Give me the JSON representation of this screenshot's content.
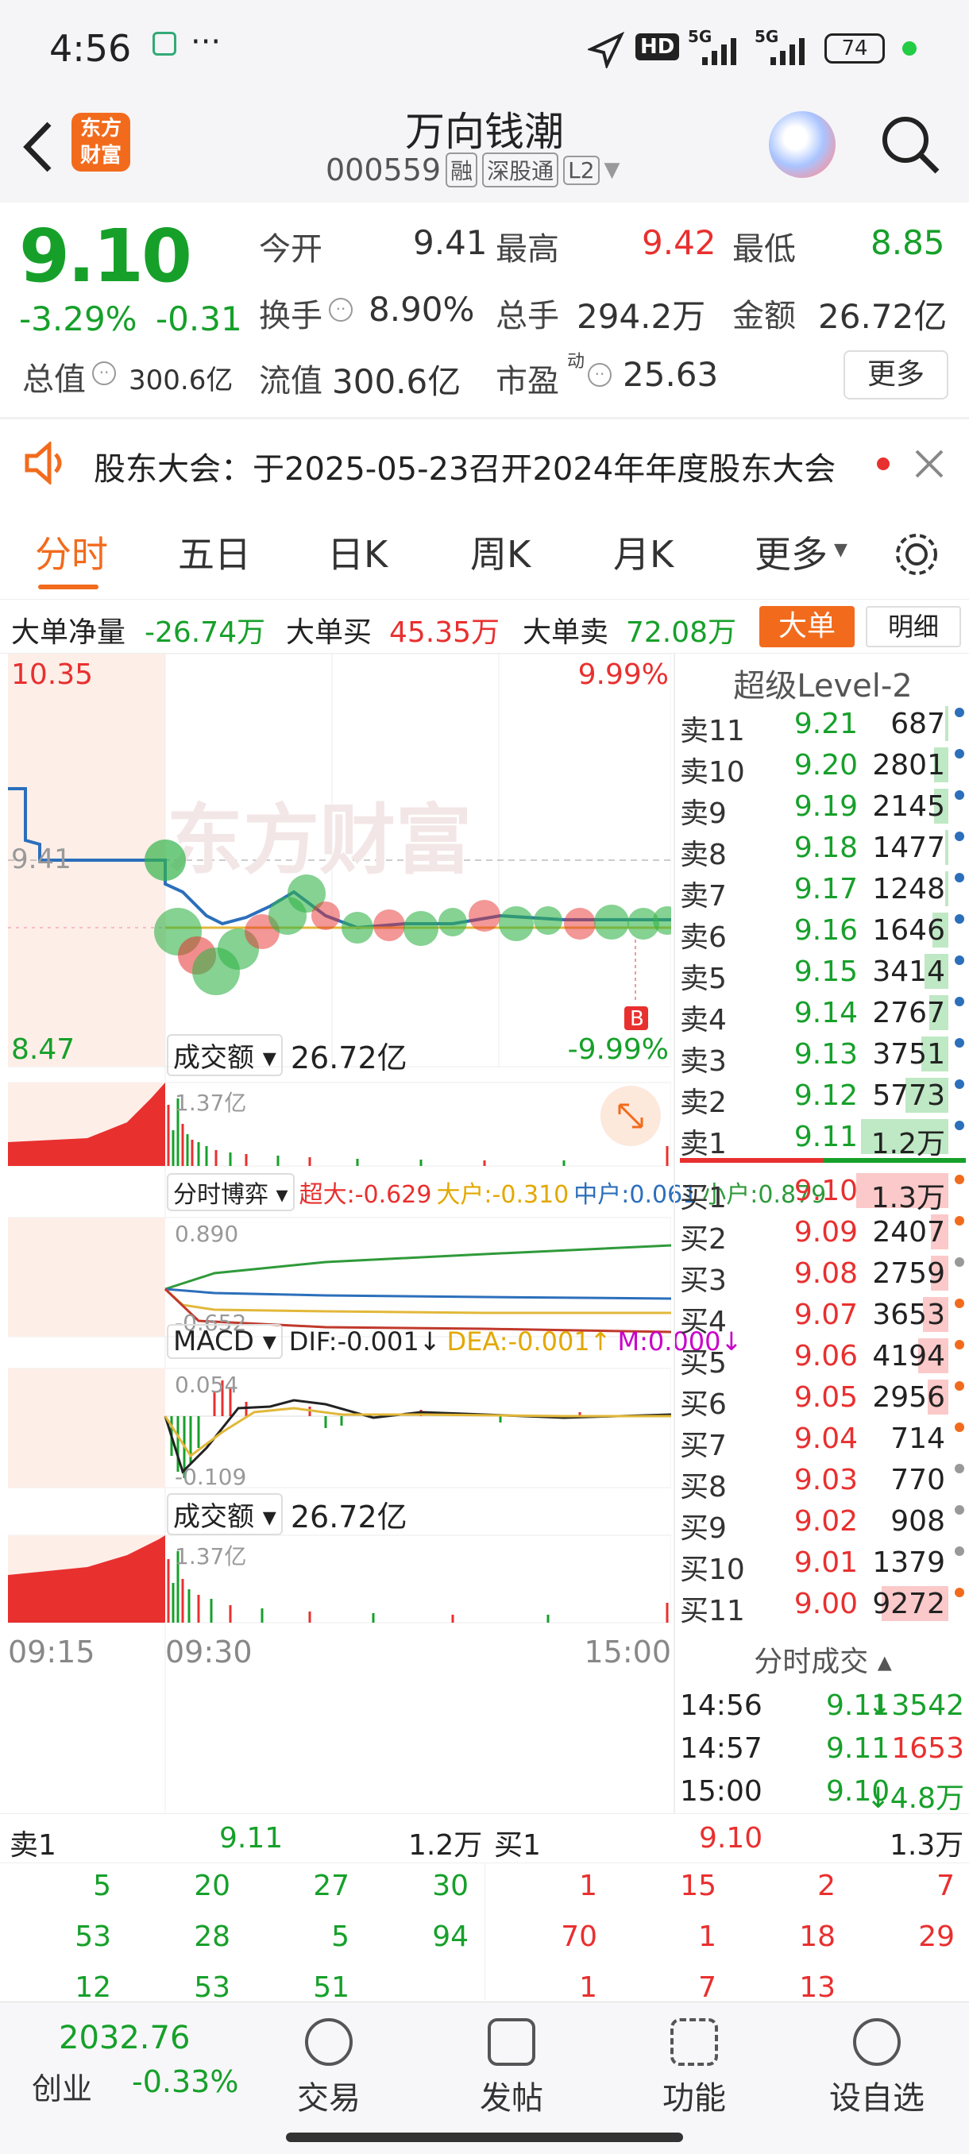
{
  "status": {
    "time": "4:56",
    "dots": "···",
    "hd": "HD",
    "sig1": "5G",
    "sig2": "5G",
    "battery": "74"
  },
  "header": {
    "title": "万向钱潮",
    "code": "000559",
    "tag_rong": "融",
    "tag_sgt": "深股通",
    "tag_l2": "L2",
    "logo_text": "东方财富"
  },
  "quote": {
    "price": "9.10",
    "pct": "-3.29%",
    "chg": "-0.31",
    "open_l": "今开",
    "open_v": "9.41",
    "high_l": "最高",
    "high_v": "9.42",
    "low_l": "最低",
    "low_v": "8.85",
    "turn_l": "换手",
    "turn_v": "8.90%",
    "vol_l": "总手",
    "vol_v": "294.2万",
    "amt_l": "金额",
    "amt_v": "26.72亿",
    "mcap_l": "总值",
    "mcap_v": "300.6亿",
    "fmcap_l": "流值",
    "fmcap_v": "300.6亿",
    "pe_l": "市盈",
    "pe_sup": "动",
    "pe_v": "25.63",
    "more": "更多"
  },
  "notice": {
    "text": "股东大会：于2025-05-23召开2024年年度股东大会"
  },
  "tabs": [
    "分时",
    "五日",
    "日K",
    "周K",
    "月K",
    "更多",
    ""
  ],
  "bigorder": {
    "net_l": "大单净量",
    "net_v": "-26.74万",
    "buy_l": "大单买",
    "buy_v": "45.35万",
    "sell_l": "大单卖",
    "sell_v": "72.08万",
    "btn": "大单",
    "detail": "明细"
  },
  "chart": {
    "ymax": "10.35",
    "ymin": "8.47",
    "pmax": "9.99%",
    "pmin": "-9.99%",
    "prev": "9.41",
    "b_mark": "B",
    "vol_title": "成交额",
    "vol_val": "26.72亿",
    "vol_max": "1.37亿",
    "game_title": "分时博弈",
    "game_big": "超大:-0.629",
    "game_large": "大户:-0.310",
    "game_mid": "中户:0.061",
    "game_small": "小户:0.879",
    "game_max": "0.890",
    "game_min": "-0.652",
    "macd_title": "MACD",
    "dif": "DIF:-0.001↓",
    "dea": "DEA:-0.001↑",
    "m": "M:0.000↓",
    "macd_max": "0.054",
    "macd_min": "-0.109",
    "vol2_title": "成交额",
    "vol2_val": "26.72亿",
    "vol2_max": "1.37亿",
    "t0": "09:15",
    "t1": "09:30",
    "t2": "15:00",
    "watermark": "东方财富"
  },
  "orderbook": {
    "title": "超级Level-2",
    "asks": [
      {
        "l": "卖11",
        "p": "9.21",
        "v": "687"
      },
      {
        "l": "卖10",
        "p": "9.20",
        "v": "2801"
      },
      {
        "l": "卖9",
        "p": "9.19",
        "v": "2145"
      },
      {
        "l": "卖8",
        "p": "9.18",
        "v": "1477"
      },
      {
        "l": "卖7",
        "p": "9.17",
        "v": "1248"
      },
      {
        "l": "卖6",
        "p": "9.16",
        "v": "1646"
      },
      {
        "l": "卖5",
        "p": "9.15",
        "v": "3414"
      },
      {
        "l": "卖4",
        "p": "9.14",
        "v": "2767"
      },
      {
        "l": "卖3",
        "p": "9.13",
        "v": "3751"
      },
      {
        "l": "卖2",
        "p": "9.12",
        "v": "5773"
      },
      {
        "l": "卖1",
        "p": "9.11",
        "v": "1.2万"
      }
    ],
    "bids": [
      {
        "l": "买1",
        "p": "9.10",
        "v": "1.3万"
      },
      {
        "l": "买2",
        "p": "9.09",
        "v": "2407"
      },
      {
        "l": "买3",
        "p": "9.08",
        "v": "2759"
      },
      {
        "l": "买4",
        "p": "9.07",
        "v": "3653"
      },
      {
        "l": "买5",
        "p": "9.06",
        "v": "4194"
      },
      {
        "l": "买6",
        "p": "9.05",
        "v": "2956"
      },
      {
        "l": "买7",
        "p": "9.04",
        "v": "714"
      },
      {
        "l": "买8",
        "p": "9.03",
        "v": "770"
      },
      {
        "l": "买9",
        "p": "9.02",
        "v": "908"
      },
      {
        "l": "买10",
        "p": "9.01",
        "v": "1379"
      },
      {
        "l": "买11",
        "p": "9.00",
        "v": "9272"
      }
    ],
    "trades_title": "分时成交",
    "trades": [
      {
        "t": "14:56",
        "p": "9.11",
        "v": "↓3542"
      },
      {
        "t": "14:57",
        "p": "9.11",
        "v": "1653"
      },
      {
        "t": "15:00",
        "p": "9.10",
        "v": "↓4.8万"
      }
    ]
  },
  "queue": {
    "sell_l": "卖1",
    "sell_p": "9.11",
    "sell_v": "1.2万",
    "buy_l": "买1",
    "buy_p": "9.10",
    "buy_v": "1.3万",
    "sell_rows": [
      [
        "5",
        "20",
        "27",
        "30"
      ],
      [
        "53",
        "28",
        "5",
        "94"
      ],
      [
        "12",
        "53",
        "51",
        ""
      ]
    ],
    "buy_rows": [
      [
        "1",
        "15",
        "2",
        "7"
      ],
      [
        "70",
        "1",
        "18",
        "29"
      ],
      [
        "1",
        "7",
        "13",
        ""
      ]
    ]
  },
  "nav": {
    "index_val": "2032.76",
    "index_name": "创业",
    "index_pct": "-0.33%",
    "trade": "交易",
    "post": "发帖",
    "func": "功能",
    "watch": "设自选"
  },
  "colors": {
    "up": "#e8302f",
    "down": "#16a02a",
    "accent": "#f26b1d"
  }
}
